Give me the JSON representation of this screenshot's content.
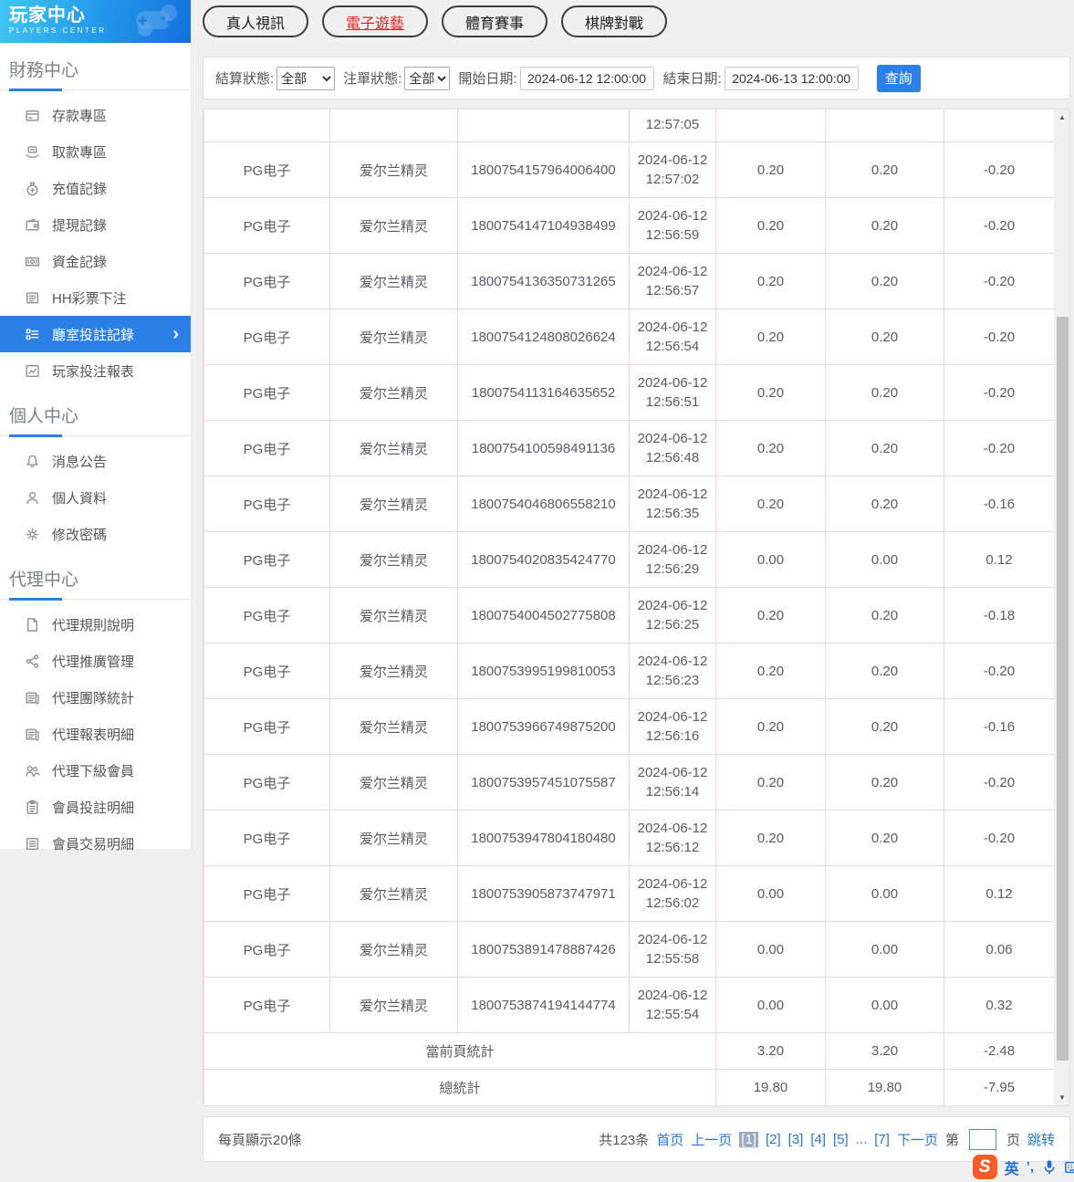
{
  "colors": {
    "accent_blue": "#2b80e8",
    "active_tab_red": "#e02121",
    "table_border_pink": "#f3d6d6",
    "sogou_orange": "#f75c28"
  },
  "sidebar": {
    "logo_title": "玩家中心",
    "logo_subtitle": "PLAYERS CENTER",
    "sections": [
      {
        "title": "財務中心",
        "items": [
          {
            "label": "存款專區",
            "icon": "deposit-icon"
          },
          {
            "label": "取款專區",
            "icon": "withdraw-icon"
          },
          {
            "label": "充值記錄",
            "icon": "recharge-record-icon"
          },
          {
            "label": "提現記錄",
            "icon": "withdrawal-record-icon"
          },
          {
            "label": "資金記錄",
            "icon": "funds-record-icon"
          },
          {
            "label": "HH彩票下注",
            "icon": "lottery-bet-icon"
          },
          {
            "label": "廳室投註記錄",
            "icon": "room-bet-record-icon",
            "active": true
          },
          {
            "label": "玩家投注報表",
            "icon": "player-bet-report-icon"
          }
        ]
      },
      {
        "title": "個人中心",
        "items": [
          {
            "label": "消息公告",
            "icon": "announcement-icon"
          },
          {
            "label": "個人資料",
            "icon": "profile-icon"
          },
          {
            "label": "修改密碼",
            "icon": "change-password-icon"
          }
        ]
      },
      {
        "title": "代理中心",
        "items": [
          {
            "label": "代理規則說明",
            "icon": "agent-rules-icon"
          },
          {
            "label": "代理推廣管理",
            "icon": "agent-promotion-icon"
          },
          {
            "label": "代理團隊統計",
            "icon": "agent-team-stats-icon"
          },
          {
            "label": "代理報表明細",
            "icon": "agent-report-icon"
          },
          {
            "label": "代理下級會員",
            "icon": "agent-members-icon"
          },
          {
            "label": "會員投註明細",
            "icon": "member-bet-detail-icon"
          },
          {
            "label": "會員交易明細",
            "icon": "member-trade-detail-icon"
          }
        ]
      }
    ]
  },
  "tabs": [
    {
      "label": "真人視訊",
      "active": false
    },
    {
      "label": "電子遊藝",
      "active": true
    },
    {
      "label": "體育賽事",
      "active": false
    },
    {
      "label": "棋牌對戰",
      "active": false
    }
  ],
  "filters": {
    "settle_status_label": "結算狀態:",
    "settle_status_value": "全部",
    "order_status_label": "注單狀態:",
    "order_status_value": "全部",
    "start_date_label": "開始日期:",
    "start_date_value": "2024-06-12 12:00:00",
    "end_date_label": "結束日期:",
    "end_date_value": "2024-06-13 12:00:00",
    "query_button": "查詢"
  },
  "table": {
    "partial_row": {
      "time": "12:57:05"
    },
    "rows": [
      {
        "provider": "PG电子",
        "game": "爱尔兰精灵",
        "order": "1800754157964006400",
        "date": "2024-06-12",
        "time": "12:57:02",
        "bet": "0.20",
        "valid": "0.20",
        "profit": "-0.20"
      },
      {
        "provider": "PG电子",
        "game": "爱尔兰精灵",
        "order": "1800754147104938499",
        "date": "2024-06-12",
        "time": "12:56:59",
        "bet": "0.20",
        "valid": "0.20",
        "profit": "-0.20"
      },
      {
        "provider": "PG电子",
        "game": "爱尔兰精灵",
        "order": "1800754136350731265",
        "date": "2024-06-12",
        "time": "12:56:57",
        "bet": "0.20",
        "valid": "0.20",
        "profit": "-0.20"
      },
      {
        "provider": "PG电子",
        "game": "爱尔兰精灵",
        "order": "1800754124808026624",
        "date": "2024-06-12",
        "time": "12:56:54",
        "bet": "0.20",
        "valid": "0.20",
        "profit": "-0.20"
      },
      {
        "provider": "PG电子",
        "game": "爱尔兰精灵",
        "order": "1800754113164635652",
        "date": "2024-06-12",
        "time": "12:56:51",
        "bet": "0.20",
        "valid": "0.20",
        "profit": "-0.20"
      },
      {
        "provider": "PG电子",
        "game": "爱尔兰精灵",
        "order": "1800754100598491136",
        "date": "2024-06-12",
        "time": "12:56:48",
        "bet": "0.20",
        "valid": "0.20",
        "profit": "-0.20"
      },
      {
        "provider": "PG电子",
        "game": "爱尔兰精灵",
        "order": "1800754046806558210",
        "date": "2024-06-12",
        "time": "12:56:35",
        "bet": "0.20",
        "valid": "0.20",
        "profit": "-0.16"
      },
      {
        "provider": "PG电子",
        "game": "爱尔兰精灵",
        "order": "1800754020835424770",
        "date": "2024-06-12",
        "time": "12:56:29",
        "bet": "0.00",
        "valid": "0.00",
        "profit": "0.12"
      },
      {
        "provider": "PG电子",
        "game": "爱尔兰精灵",
        "order": "1800754004502775808",
        "date": "2024-06-12",
        "time": "12:56:25",
        "bet": "0.20",
        "valid": "0.20",
        "profit": "-0.18"
      },
      {
        "provider": "PG电子",
        "game": "爱尔兰精灵",
        "order": "1800753995199810053",
        "date": "2024-06-12",
        "time": "12:56:23",
        "bet": "0.20",
        "valid": "0.20",
        "profit": "-0.20"
      },
      {
        "provider": "PG电子",
        "game": "爱尔兰精灵",
        "order": "1800753966749875200",
        "date": "2024-06-12",
        "time": "12:56:16",
        "bet": "0.20",
        "valid": "0.20",
        "profit": "-0.16"
      },
      {
        "provider": "PG电子",
        "game": "爱尔兰精灵",
        "order": "1800753957451075587",
        "date": "2024-06-12",
        "time": "12:56:14",
        "bet": "0.20",
        "valid": "0.20",
        "profit": "-0.20"
      },
      {
        "provider": "PG电子",
        "game": "爱尔兰精灵",
        "order": "1800753947804180480",
        "date": "2024-06-12",
        "time": "12:56:12",
        "bet": "0.20",
        "valid": "0.20",
        "profit": "-0.20"
      },
      {
        "provider": "PG电子",
        "game": "爱尔兰精灵",
        "order": "1800753905873747971",
        "date": "2024-06-12",
        "time": "12:56:02",
        "bet": "0.00",
        "valid": "0.00",
        "profit": "0.12"
      },
      {
        "provider": "PG电子",
        "game": "爱尔兰精灵",
        "order": "1800753891478887426",
        "date": "2024-06-12",
        "time": "12:55:58",
        "bet": "0.00",
        "valid": "0.00",
        "profit": "0.06"
      },
      {
        "provider": "PG电子",
        "game": "爱尔兰精灵",
        "order": "1800753874194144774",
        "date": "2024-06-12",
        "time": "12:55:54",
        "bet": "0.00",
        "valid": "0.00",
        "profit": "0.32"
      }
    ],
    "summary_rows": [
      {
        "label": "當前頁統計",
        "bet": "3.20",
        "valid": "3.20",
        "profit": "-2.48"
      },
      {
        "label": "總統計",
        "bet": "19.80",
        "valid": "19.80",
        "profit": "-7.95"
      }
    ]
  },
  "pagination": {
    "page_size_text": "每頁顯示20條",
    "total_text": "共123条",
    "first": "首页",
    "prev": "上一页",
    "pages": [
      {
        "label": "[1]",
        "current": true
      },
      {
        "label": "[2]"
      },
      {
        "label": "[3]"
      },
      {
        "label": "[4]"
      },
      {
        "label": "[5]"
      },
      {
        "label": "..."
      },
      {
        "label": "[7]"
      }
    ],
    "next": "下一页",
    "jump_prefix": "第",
    "jump_value": "",
    "jump_suffix": "页",
    "jump_action": "跳转"
  },
  "ime_bar": {
    "logo_letter": "S",
    "lang_indicator": "英",
    "punct_indicator": "’,"
  }
}
